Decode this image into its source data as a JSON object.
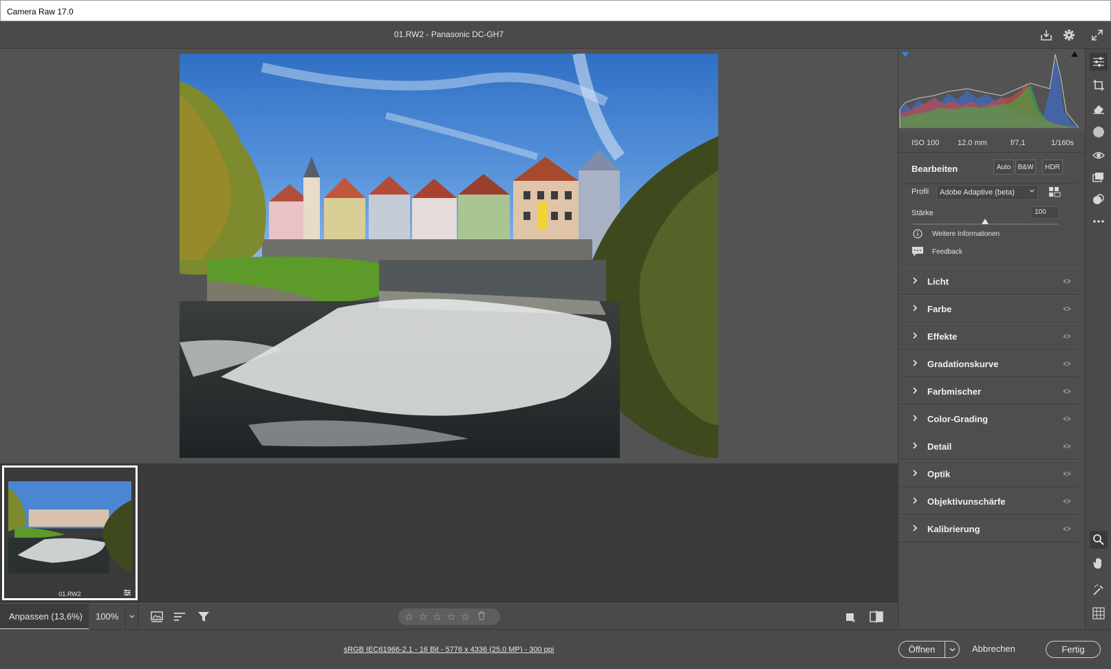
{
  "window": {
    "title": "Camera Raw 17.0"
  },
  "header": {
    "file_title": "01.RW2 - Panasonic DC-GH7"
  },
  "filmstrip": {
    "thumbnail": {
      "name": "01.RW2"
    }
  },
  "toolbar": {
    "fit_label": "Anpassen (13,6%)",
    "zoom_label": "100%",
    "rating": {
      "stars": 5,
      "value": 0
    }
  },
  "status": {
    "image_info": "sRGB IEC61966-2.1 - 16 Bit - 5776 x 4336 (25,0 MP) - 300 ppi",
    "open_label": "Öffnen",
    "cancel_label": "Abbrechen",
    "done_label": "Fertig"
  },
  "exif": {
    "iso": "ISO 100",
    "focal": "12.0 mm",
    "aperture": "f/7,1",
    "shutter": "1/160s"
  },
  "edit": {
    "heading": "Bearbeiten",
    "auto_label": "Auto",
    "bw_label": "B&W",
    "hdr_label": "HDR",
    "profile_label": "Profil",
    "profile_value": "Adobe Adaptive (beta)",
    "amount_label": "Stärke",
    "amount_value": "100",
    "more_info_label": "Weitere Informationen",
    "feedback_label": "Feedback"
  },
  "sections": [
    {
      "label": "Licht"
    },
    {
      "label": "Farbe"
    },
    {
      "label": "Effekte"
    },
    {
      "label": "Gradationskurve"
    },
    {
      "label": "Farbmischer"
    },
    {
      "label": "Color-Grading"
    },
    {
      "label": "Detail"
    },
    {
      "label": "Optik"
    },
    {
      "label": "Objektivunschärfe"
    },
    {
      "label": "Kalibrierung"
    }
  ],
  "colors": {
    "accent": "#2d8ceb",
    "panel": "#4e4e4e",
    "workspace": "#535353",
    "histogram_red": "#d8453a",
    "histogram_green": "#3fae49",
    "histogram_blue": "#3a6fd8"
  },
  "icons": {
    "header": [
      "save-icon",
      "settings-gear-icon",
      "fullscreen-expand-icon"
    ],
    "tools": [
      "edit-sliders-icon",
      "crop-icon",
      "eraser-icon",
      "masking-icon",
      "red-eye-icon",
      "presets-icon",
      "snapshot-icon",
      "more-icon",
      "zoom-icon",
      "hand-icon",
      "color-sampler-icon",
      "grid-icon"
    ]
  }
}
